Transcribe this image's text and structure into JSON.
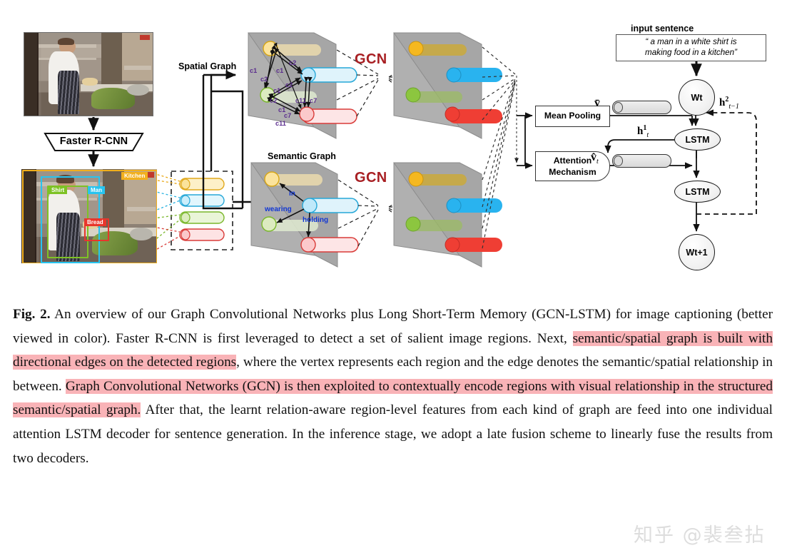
{
  "figure": {
    "pipeline_label": "Faster R-CNN",
    "spatial_graph_label": "Spatial Graph",
    "semantic_graph_label": "Semantic Graph",
    "gcn_label_spatial": "GCN",
    "gcn_label_semantic": "GCN",
    "input_sentence_label": "input sentence",
    "input_sentence_line1": "“ a man in a white shirt is",
    "input_sentence_line2": "making food in a kitchen”",
    "mean_pooling_label": "Mean Pooling",
    "attention_line1": "Attention",
    "attention_line2": "Mechanism",
    "lstm_label_1": "LSTM",
    "lstm_label_2": "LSTM",
    "word_in_label": "Wt",
    "word_out_label": "Wt+1",
    "v_bar_symbol": "v̄",
    "v_hat_symbol": "v̂t",
    "h1_symbol": "h¹t",
    "h2_symbol": "h²t−1",
    "detections": [
      {
        "label": "Kitchen",
        "color": "#f2b01e"
      },
      {
        "label": "Shirt",
        "color": "#7ec225"
      },
      {
        "label": "Man",
        "color": "#27c4f0"
      },
      {
        "label": "Bread",
        "color": "#e8362c"
      }
    ],
    "spatial_edge_labels": [
      "c1",
      "c2",
      "c2",
      "c1",
      "c2",
      "c1",
      "c2",
      "c1",
      "c2",
      "c11",
      "c7",
      "c7",
      "c11"
    ],
    "semantic_edge_labels": [
      "in",
      "wearing",
      "holding"
    ],
    "region_colors": [
      "#f2b01e",
      "#27c4f0",
      "#7ec225",
      "#e8362c"
    ],
    "gcn_text_color": "#a81f23",
    "highlight_color": "#f9b3b7"
  },
  "caption": {
    "prefix": "Fig. 2.",
    "seg1": " An overview of our Graph Convolutional Networks plus Long Short-Term Memory (GCN-LSTM) for image captioning (better viewed in color). Faster R-CNN is first leveraged to detect a set of salient image regions. Next, ",
    "hl1": "semantic/spatial graph is built with directional edges on the detected regions",
    "seg2": ", where the vertex represents each region and the edge denotes the semantic/spatial relationship in between. ",
    "hl2": "Graph Convolutional Networks (GCN) is then exploited to contextually encode regions with visual relationship in the structured semantic/spatial graph.",
    "seg3": " After that, the learnt relation-aware region-level features from each kind of graph are feed into one individual attention LSTM decoder for sentence generation. In the inference stage, we adopt a late fusion scheme to linearly fuse the results from two decoders."
  },
  "watermark": {
    "text": "知乎 @裴叁拈"
  }
}
